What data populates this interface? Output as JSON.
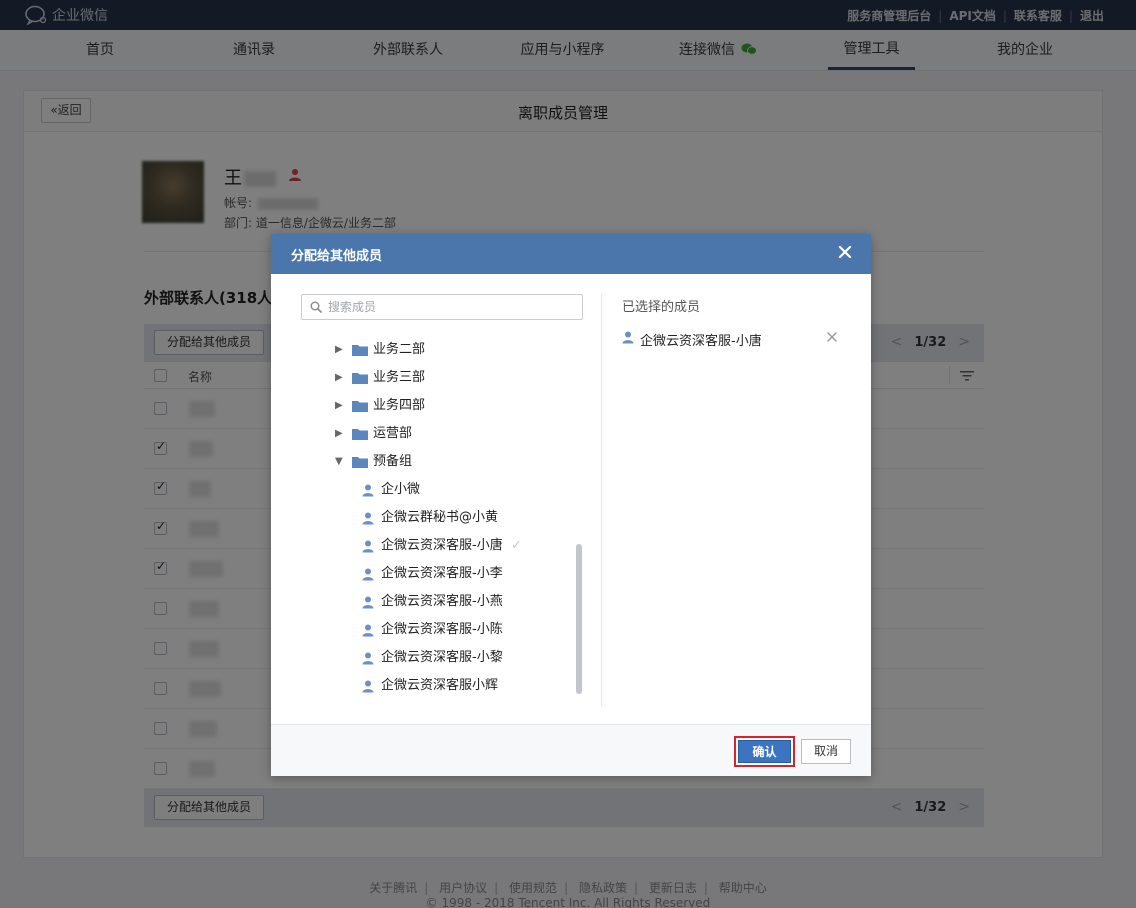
{
  "topbar": {
    "logo_text": "企业微信",
    "links": [
      "服务商管理后台",
      "API文档",
      "联系客服",
      "退出"
    ],
    "sep": "|"
  },
  "nav": {
    "items": [
      "首页",
      "通讯录",
      "外部联系人",
      "应用与小程序",
      "连接微信",
      "管理工具",
      "我的企业"
    ],
    "active": "管理工具"
  },
  "page": {
    "back_label": "返回",
    "title": "离职成员管理",
    "profile": {
      "name_prefix": "王",
      "account_label": "帐号:",
      "dept_label": "部门:",
      "dept_value": "道一信息/企微云/业务二部"
    },
    "ext_title": "外部联系人(318人",
    "assign_button": "分配给其他成员",
    "pager": {
      "current": "1/32"
    },
    "table": {
      "col_name": "名称",
      "rows_checked": [
        false,
        true,
        true,
        true,
        true,
        false,
        false,
        false,
        false,
        false
      ]
    }
  },
  "dialog": {
    "title": "分配给其他成员",
    "search_placeholder": "搜索成员",
    "departments": [
      {
        "label": "业务二部",
        "expanded": false
      },
      {
        "label": "业务三部",
        "expanded": false
      },
      {
        "label": "业务四部",
        "expanded": false
      },
      {
        "label": "运营部",
        "expanded": false
      },
      {
        "label": "预备组",
        "expanded": true
      }
    ],
    "members": [
      {
        "label": "企小微",
        "selected": false
      },
      {
        "label": "企微云群秘书@小黄",
        "selected": false
      },
      {
        "label": "企微云资深客服-小唐",
        "selected": true
      },
      {
        "label": "企微云资深客服-小李",
        "selected": false
      },
      {
        "label": "企微云资深客服-小燕",
        "selected": false
      },
      {
        "label": "企微云资深客服-小陈",
        "selected": false
      },
      {
        "label": "企微云资深客服-小黎",
        "selected": false
      },
      {
        "label": "企微云资深客服小辉",
        "selected": false
      }
    ],
    "selected_title": "已选择的成员",
    "selected_members": [
      "企微云资深客服-小唐"
    ],
    "confirm_label": "确认",
    "cancel_label": "取消"
  },
  "footer": {
    "links": [
      "关于腾讯",
      "用户协议",
      "使用规范",
      "隐私政策",
      "更新日志",
      "帮助中心"
    ],
    "copyright": "© 1998 - 2018 Tencent Inc. All Rights Reserved"
  },
  "colors": {
    "topbar": "#29344a",
    "dialog_header": "#4a76ac",
    "confirm_button": "#3b74c1",
    "highlight_border": "#d5232b",
    "wechat_green": "#3aaa35"
  }
}
